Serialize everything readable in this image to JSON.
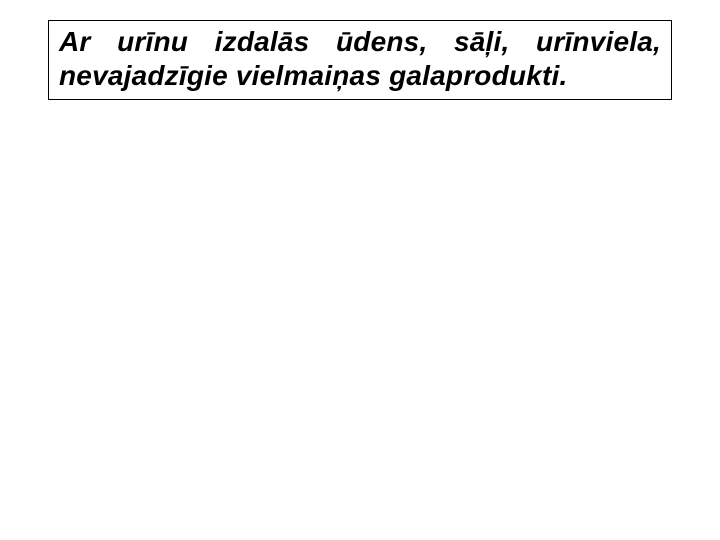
{
  "slide": {
    "body_text": "Ar urīnu izdalās ūdens, sāļi, urīnviela, nevajadzīgie vielmaiņas galaprodukti."
  }
}
